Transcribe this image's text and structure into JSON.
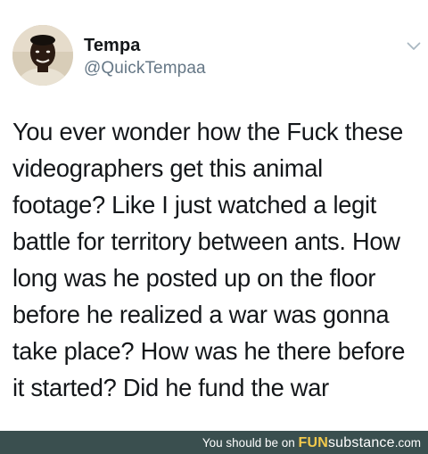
{
  "tweet": {
    "display_name": "Tempa",
    "handle": "@QuickTempaa",
    "text": "You ever wonder how the Fuck these\nvideographers get this animal\nfootage? Like I just watched a legit\nbattle for territory between ants. How\nlong was he posted up on the floor\nbefore he realized a war was gonna\ntake place? How was he there before\nit started? Did he fund the war",
    "menu_icon": "chevron-down-icon",
    "avatar_icon": "user-avatar"
  },
  "footer": {
    "prefix": "You should be on ",
    "brand_fun": "FUN",
    "brand_rest": "substance",
    "suffix": ".com",
    "bg_color": "#3a4f4f",
    "brand_accent": "#f2c94c"
  }
}
